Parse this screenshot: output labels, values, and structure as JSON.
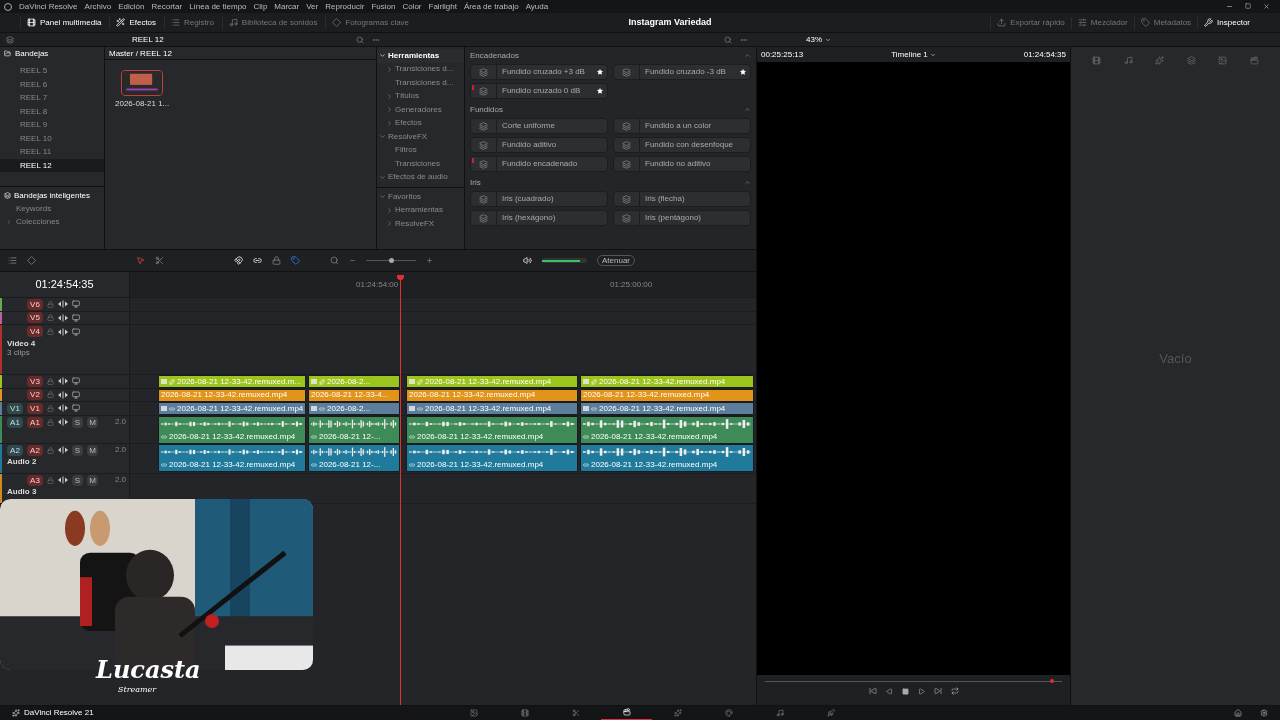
{
  "menu_bar": {
    "items": [
      "DaVinci Resolve",
      "Archivo",
      "Edición",
      "Recortar",
      "Línea de tiempo",
      "Clip",
      "Marcar",
      "Ver",
      "Reproducir",
      "Fusion",
      "Color",
      "Fairlight",
      "Área de trabajo",
      "Ayuda"
    ]
  },
  "toolbar": {
    "left": [
      {
        "label": "Panel multimedia",
        "selected": true
      },
      {
        "label": "Efectos",
        "selected": true
      },
      {
        "label": "Registro",
        "selected": false
      },
      {
        "label": "Biblioteca de sonidos",
        "selected": false
      },
      {
        "label": "Fotogramas clave",
        "selected": false
      }
    ],
    "title": "Instagram Variedad",
    "right": [
      {
        "label": "Exportar rápido",
        "selected": false
      },
      {
        "label": "Mezclador",
        "selected": false
      },
      {
        "label": "Metadatos",
        "selected": false
      },
      {
        "label": "Inspector",
        "selected": true
      }
    ]
  },
  "subbar": {
    "bin": "REEL 12",
    "zoom": "43%"
  },
  "bins": {
    "title": "Bandejas",
    "items": [
      {
        "label": "REEL 5",
        "selected": false
      },
      {
        "label": "REEL 6",
        "selected": false
      },
      {
        "label": "REEL 7",
        "selected": false
      },
      {
        "label": "REEL 8",
        "selected": false
      },
      {
        "label": "REEL 9",
        "selected": false
      },
      {
        "label": "REEL 10",
        "selected": false
      },
      {
        "label": "REEL 11",
        "selected": false
      },
      {
        "label": "REEL 12",
        "selected": true
      }
    ],
    "smart_title": "Bandejas inteligentes",
    "smart_items": [
      {
        "label": "Keywords"
      },
      {
        "label": "Colecciones",
        "expanded": false
      }
    ]
  },
  "media_pool": {
    "path": "Master / REEL 12",
    "clips": [
      {
        "name": "2026-08-21 1..."
      }
    ]
  },
  "effects_tree": {
    "main": [
      {
        "label": "Herramientas",
        "expanded": true,
        "selected": true,
        "children": [
          {
            "label": "Transiciones d...",
            "expanded": false,
            "selected": false
          },
          {
            "label": "Transiciones d...",
            "selected": false
          },
          {
            "label": "Títulos",
            "expanded": false,
            "selected": false
          },
          {
            "label": "Generadores",
            "expanded": false,
            "selected": false
          },
          {
            "label": "Efectos",
            "expanded": false,
            "selected": false
          }
        ]
      },
      {
        "label": "ResolveFX",
        "expanded": true,
        "selected": false,
        "children": [
          {
            "label": "Filtros",
            "selected": false
          },
          {
            "label": "Transiciones",
            "selected": false
          }
        ]
      },
      {
        "label": "Efectos de audio",
        "expanded": true,
        "selected": false
      }
    ],
    "favorites": [
      {
        "label": "Favoritos",
        "expanded": true,
        "selected": false,
        "children": [
          {
            "label": "Herramientas",
            "expanded": false,
            "selected": false
          },
          {
            "label": "ResolveFX",
            "expanded": false,
            "selected": false
          }
        ]
      }
    ]
  },
  "effects_library": [
    {
      "title": "Encadenados",
      "items": [
        {
          "label": "Fundido cruzado +3 dB",
          "favorite": true,
          "marked": false
        },
        {
          "label": "Fundido cruzado -3 dB",
          "favorite": true,
          "marked": false
        },
        {
          "label": "Fundido cruzado 0 dB",
          "favorite": true,
          "marked": true
        }
      ]
    },
    {
      "title": "Fundidos",
      "items": [
        {
          "label": "Corte uniforme",
          "favorite": false,
          "marked": false
        },
        {
          "label": "Fundido a un color",
          "favorite": false,
          "marked": false
        },
        {
          "label": "Fundido aditivo",
          "favorite": false,
          "marked": false
        },
        {
          "label": "Fundido con desenfoque",
          "favorite": false,
          "marked": false
        },
        {
          "label": "Fundido encadenado",
          "favorite": false,
          "marked": true
        },
        {
          "label": "Fundido no aditivo",
          "favorite": false,
          "marked": false
        }
      ]
    },
    {
      "title": "Iris",
      "items": [
        {
          "label": "Iris (cuadrado)",
          "favorite": false,
          "marked": false
        },
        {
          "label": "Iris (flecha)",
          "favorite": false,
          "marked": false
        },
        {
          "label": "Iris (hexágono)",
          "favorite": false,
          "marked": false
        },
        {
          "label": "Iris (pentágono)",
          "favorite": false,
          "marked": false
        }
      ]
    }
  ],
  "timeline": {
    "timecode": "01:24:54:35",
    "ruler": [
      "01:24:54:00",
      "01:25:00:00"
    ],
    "zoom": {
      "level": 0.5
    },
    "volume": {
      "level": 0.85
    },
    "mute_button": "Atenuar",
    "tracks": [
      {
        "kind": "video",
        "label": "V6",
        "color": "#6aa84f"
      },
      {
        "kind": "video",
        "label": "V5",
        "color": "#c060a0"
      },
      {
        "kind": "video",
        "label": "V4",
        "color": "#b03030",
        "name": "Video 4",
        "info": "3 clips"
      },
      {
        "kind": "video",
        "label": "V3",
        "color": "#9bc41c",
        "clips": [
          "2026-08-21 12-33-42.remuxed.m...",
          "2026-08-2...",
          "2026-08-21 12-33-42.remuxed.mp4",
          "2026-08-21 12-33-42.remuxed.mp4"
        ]
      },
      {
        "kind": "video",
        "label": "V2",
        "color": "#e29419",
        "clips": [
          "2026-08-21 12-33-42.remuxed.mp4",
          "2026-08-21 12-33-4...",
          "2026-08-21 12-33-42.remuxed.mp4",
          "2026-08-21 12-33-42.remuxed.mp4"
        ]
      },
      {
        "kind": "video",
        "label": "V1",
        "patch": "V1",
        "color": "#5b7e9c",
        "clips": [
          "2026-08-21 12-33-42.remuxed.mp4",
          "2026-08-2...",
          "2026-08-21 12-33-42.remuxed.mp4",
          "2026-08-21 12-33-42.remuxed.mp4"
        ]
      },
      {
        "kind": "audio",
        "label": "A1",
        "patch": "A1",
        "color": "#3f8b57",
        "solo": "S",
        "mute": "M",
        "format": "2.0",
        "clips": [
          "2026-08-21 12-33-42.remuxed.mp4",
          "2026-08-21 12-...",
          "2026-08-21 12-33-42.remuxed.mp4",
          "2026-08-21 12-33-42.remuxed.mp4"
        ]
      },
      {
        "kind": "audio",
        "label": "A2",
        "patch": "A2",
        "color": "#1f7a9c",
        "name": "Audio 2",
        "solo": "S",
        "mute": "M",
        "format": "2.0",
        "clips": [
          "2026-08-21 12-33-42.remuxed.mp4",
          "2026-08-21 12-...",
          "2026-08-21 12-33-42.remuxed.mp4",
          "2026-08-21 12-33-42.remuxed.mp4"
        ]
      },
      {
        "kind": "audio",
        "label": "A3",
        "color": "#d08a20",
        "name": "Audio 3",
        "solo": "S",
        "mute": "M",
        "format": "2.0"
      }
    ]
  },
  "viewer": {
    "source_timecode": "00:25:25:13",
    "timeline_name": "Timeline 1",
    "timecode": "01:24:54:35"
  },
  "inspector": {
    "empty_label": "Vacío"
  },
  "overlay": {
    "name": "Lucasta",
    "tagline": "Streamer"
  },
  "status_bar": {
    "app": "DaVinci Resolve 21",
    "pages": [
      {
        "selected": false
      },
      {
        "selected": false
      },
      {
        "selected": false
      },
      {
        "selected": true
      },
      {
        "selected": false
      },
      {
        "selected": false
      },
      {
        "selected": false
      },
      {
        "selected": false
      }
    ]
  }
}
